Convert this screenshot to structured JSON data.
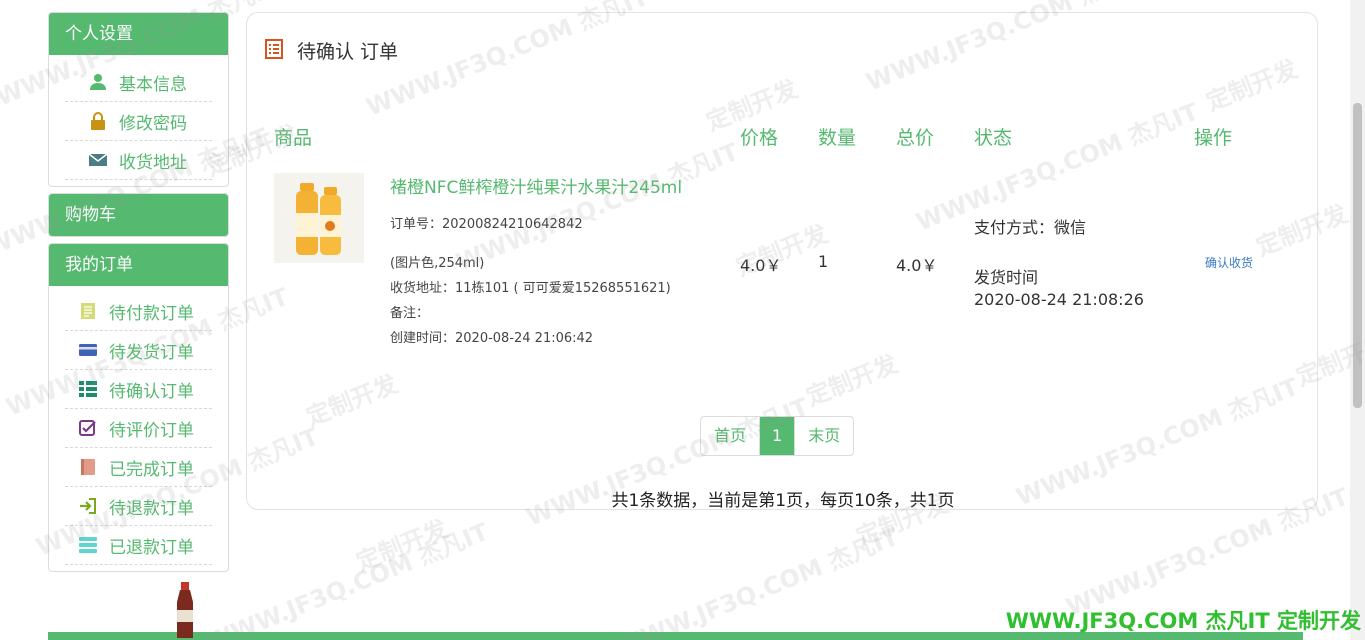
{
  "sidebar": {
    "personal": {
      "title": "个人设置",
      "items": [
        {
          "label": "基本信息",
          "icon": "user-icon"
        },
        {
          "label": "修改密码",
          "icon": "lock-icon"
        },
        {
          "label": "收货地址",
          "icon": "envelope-icon"
        }
      ]
    },
    "cart": {
      "title": "购物车"
    },
    "orders": {
      "title": "我的订单",
      "items": [
        {
          "label": "待付款订单",
          "icon": "document-icon"
        },
        {
          "label": "待发货订单",
          "icon": "credit-card-icon"
        },
        {
          "label": "待确认订单",
          "icon": "list-icon"
        },
        {
          "label": "待评价订单",
          "icon": "check-square-icon"
        },
        {
          "label": "已完成订单",
          "icon": "book-icon"
        },
        {
          "label": "待退款订单",
          "icon": "sign-in-icon"
        },
        {
          "label": "已退款订单",
          "icon": "stack-icon"
        }
      ]
    }
  },
  "main": {
    "title": "待确认 订单",
    "columns": {
      "product": "商品",
      "price": "价格",
      "qty": "数量",
      "total": "总价",
      "status": "状态",
      "action": "操作"
    },
    "order": {
      "product_name": "褚橙NFC鲜榨橙汁纯果汁水果汁245ml",
      "order_no": "订单号：20200824210642842",
      "spec": "(图片色,254ml)",
      "address": "收货地址：11栋101 ( 可可爱爱15268551621)",
      "remark": "备注：",
      "created": "创建时间：2020-08-24 21:06:42",
      "price": "4.0￥",
      "qty": "1",
      "total": "4.0￥",
      "payment": "支付方式：微信",
      "ship_label": "发货时间",
      "ship_time": "2020-08-24 21:08:26",
      "action": "确认收货"
    },
    "pager": {
      "first": "首页",
      "current": "1",
      "last": "末页"
    },
    "summary": "共1条数据，当前是第1页，每页10条，共1页"
  },
  "watermark": {
    "brand": "WWW.JF3Q.COM 杰凡IT  定制开发",
    "tile_a": "WWW.JF3Q.COM 杰凡IT",
    "tile_b": "定制开发"
  },
  "colors": {
    "accent": "#55b970",
    "link": "#3a7bbf",
    "brand_watermark": "#2fbf2f"
  }
}
